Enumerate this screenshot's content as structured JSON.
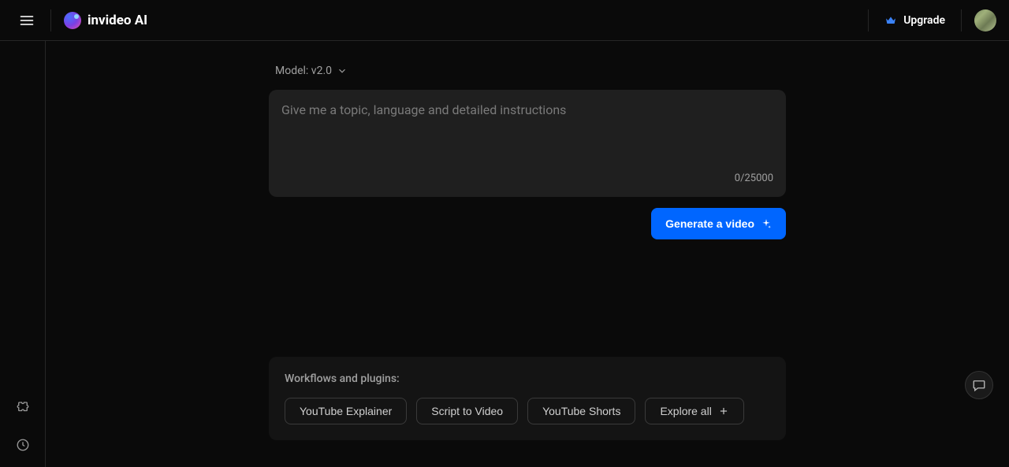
{
  "header": {
    "brand": "invideo AI",
    "upgrade_label": "Upgrade"
  },
  "model": {
    "label": "Model: v2.0"
  },
  "prompt": {
    "placeholder": "Give me a topic, language and detailed instructions",
    "value": "",
    "char_count": "0/25000"
  },
  "actions": {
    "generate_label": "Generate a video"
  },
  "workflows": {
    "title": "Workflows and plugins:",
    "items": [
      {
        "label": "YouTube Explainer"
      },
      {
        "label": "Script to Video"
      },
      {
        "label": "YouTube Shorts"
      },
      {
        "label": "Explore all"
      }
    ]
  }
}
